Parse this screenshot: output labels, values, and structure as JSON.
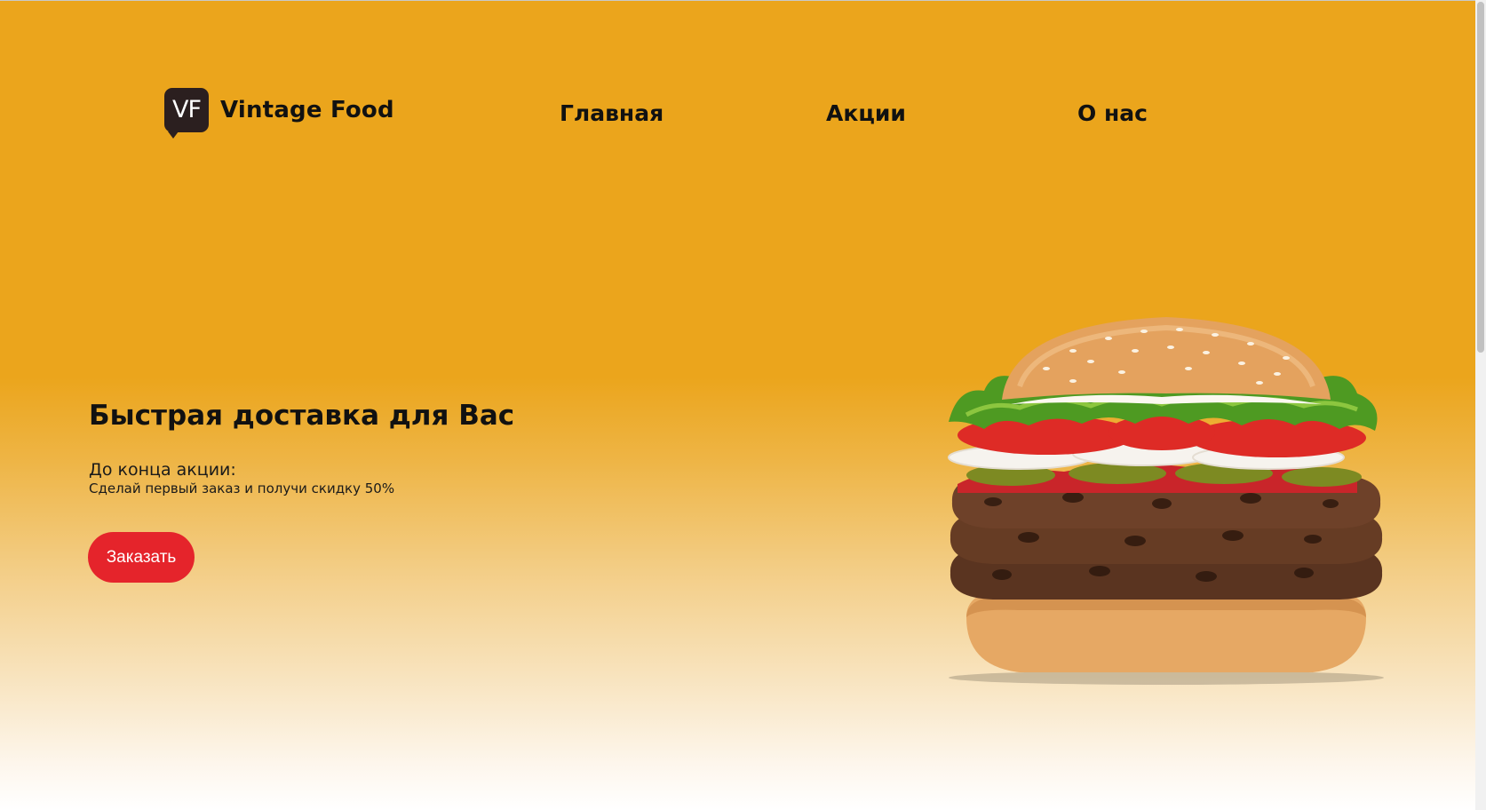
{
  "brand": {
    "logo_mark": "VF",
    "name": "Vintage Food"
  },
  "nav": {
    "items": [
      {
        "label": "Главная"
      },
      {
        "label": "Акции"
      },
      {
        "label": "О нас"
      }
    ]
  },
  "hero": {
    "title": "Быстрая доставка для Вас",
    "countdown_label": "До конца акции:",
    "subtitle": "Сделай первый заказ и получи скидку 50%",
    "cta_label": "Заказать",
    "image": "burger-image"
  },
  "colors": {
    "background": "#eba51c",
    "cta": "#e5242b",
    "logo_bg": "#2b1f1f",
    "text": "#111111"
  }
}
